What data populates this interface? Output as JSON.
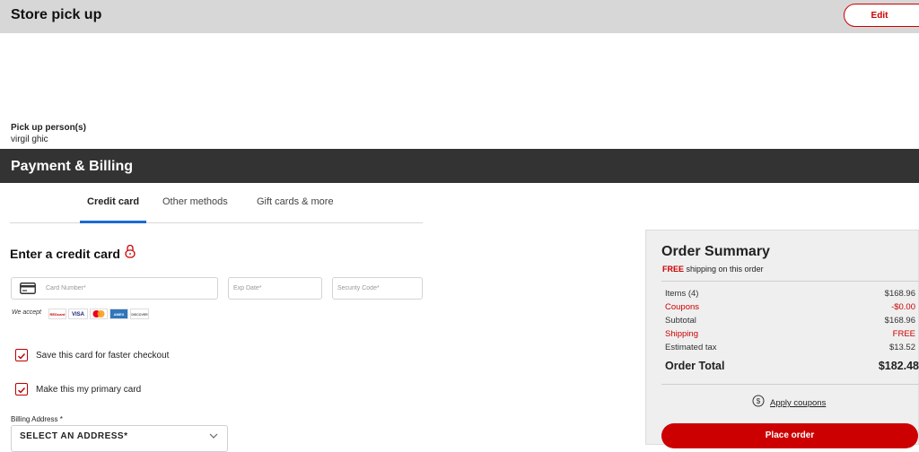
{
  "pickup": {
    "title": "Store pick up",
    "edit_label": "Edit",
    "person_label": "Pick up person(s)",
    "person_name": "virgil ghic"
  },
  "payment": {
    "title": "Payment & Billing",
    "tabs": [
      {
        "label": "Credit card",
        "active": true
      },
      {
        "label": "Other methods",
        "active": false
      },
      {
        "label": "Gift cards & more",
        "active": false
      }
    ],
    "enter_title": "Enter a credit card",
    "card_number_placeholder": "Card Number*",
    "exp_date_placeholder": "Exp Date*",
    "security_code_placeholder": "Security Code*",
    "we_accept": "We accept",
    "accepted_cards": [
      "REDcard",
      "VISA",
      "Mastercard",
      "AMEX",
      "DISCOVER"
    ],
    "save_card_label": "Save this card for faster checkout",
    "save_card_checked": true,
    "primary_card_label": "Make this my primary card",
    "primary_card_checked": true,
    "billing_label": "Billing Address *",
    "billing_select_value": "SELECT AN ADDRESS*"
  },
  "summary": {
    "title": "Order Summary",
    "free_word": "FREE",
    "free_rest": " shipping on this order",
    "rows": [
      {
        "label": "Items (4)",
        "value": "$168.96",
        "highlight": false
      },
      {
        "label": "Coupons",
        "value": "-$0.00",
        "highlight": true
      },
      {
        "label": "Subtotal",
        "value": "$168.96",
        "highlight": false
      },
      {
        "label": "Shipping",
        "value": "FREE",
        "highlight": true
      },
      {
        "label": "Estimated tax",
        "value": "$13.52",
        "highlight": false
      }
    ],
    "total_label": "Order Total",
    "total_value": "$182.48",
    "apply_coupons": "Apply coupons",
    "place_order": "Place order"
  },
  "colors": {
    "accent_red": "#cc0000",
    "tab_underline_blue": "#1a6ad6",
    "dark_bar": "#333333",
    "gray_bar": "#d7d7d7"
  }
}
